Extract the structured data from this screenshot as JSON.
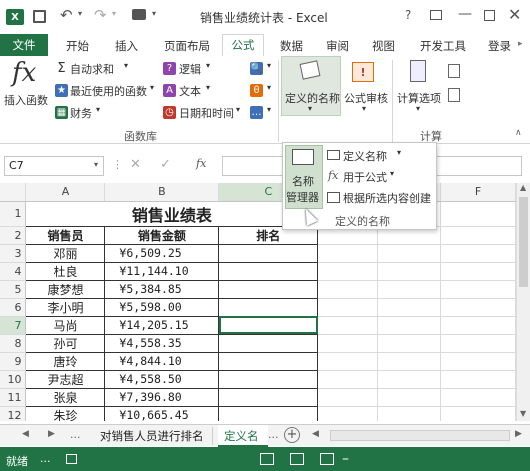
{
  "window": {
    "title": "销售业绩统计表 - Excel",
    "help": "?"
  },
  "tabs": {
    "file": "文件",
    "home": "开始",
    "insert": "插入",
    "layout": "页面布局",
    "formulas": "公式",
    "data": "数据",
    "review": "审阅",
    "view": "视图",
    "developer": "开发工具",
    "login": "登录"
  },
  "ribbon": {
    "insert_function": "插入函数",
    "autosum": "自动求和",
    "recent": "最近使用的函数",
    "financial": "财务",
    "logical": "逻辑",
    "text": "文本",
    "datetime": "日期和时间",
    "group_library": "函数库",
    "define_name": "定义的名称",
    "audit": "公式审核",
    "calc_options": "计算选项",
    "group_calc": "计算"
  },
  "dropdown": {
    "name_manager_1": "名称",
    "name_manager_2": "管理器",
    "define_name": "定义名称",
    "use_in_formula": "用于公式",
    "create_from_selection": "根据所选内容创建",
    "group_label": "定义的名称"
  },
  "formula_bar": {
    "name_box": "C7",
    "fx": "fx"
  },
  "columns": [
    "A",
    "B",
    "C",
    "F"
  ],
  "sheet": {
    "title": "销售业绩表",
    "headers": [
      "销售员",
      "销售金额",
      "排名"
    ],
    "rows": [
      {
        "r": "3",
        "name": "邓丽",
        "amt": "¥6,509.25"
      },
      {
        "r": "4",
        "name": "杜良",
        "amt": "¥11,144.10"
      },
      {
        "r": "5",
        "name": "康梦想",
        "amt": "¥5,384.85"
      },
      {
        "r": "6",
        "name": "李小明",
        "amt": "¥5,598.00"
      },
      {
        "r": "7",
        "name": "马尚",
        "amt": "¥14,205.15"
      },
      {
        "r": "8",
        "name": "孙可",
        "amt": "¥4,558.35"
      },
      {
        "r": "9",
        "name": "唐玲",
        "amt": "¥4,844.10"
      },
      {
        "r": "10",
        "name": "尹志超",
        "amt": "¥4,558.50"
      },
      {
        "r": "11",
        "name": "张泉",
        "amt": "¥7,396.80"
      },
      {
        "r": "12",
        "name": "朱珍",
        "amt": "¥10,665.45"
      }
    ]
  },
  "sheet_tabs": {
    "tab1": "对销售人员进行排名",
    "tab2": "定义名",
    "more": "..."
  },
  "status": {
    "ready": "就绪",
    "dots": "..."
  },
  "colors": {
    "excel_green": "#217346",
    "orange": "#e36c0a"
  }
}
